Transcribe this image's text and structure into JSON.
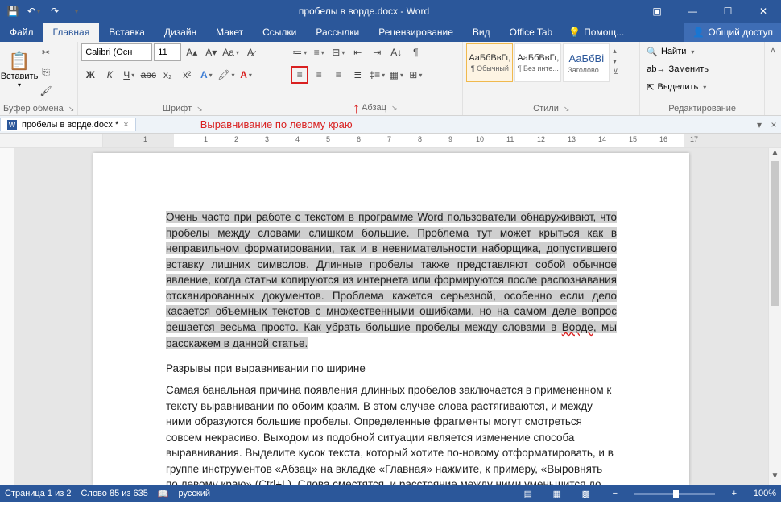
{
  "title": "пробелы в ворде.docx - Word",
  "qat": {
    "save": "💾",
    "undo": "↶",
    "redo": "↷"
  },
  "tabs": {
    "file": "Файл",
    "items": [
      "Главная",
      "Вставка",
      "Дизайн",
      "Макет",
      "Ссылки",
      "Рассылки",
      "Рецензирование",
      "Вид",
      "Office Tab"
    ],
    "help": "Помощ...",
    "share": "Общий доступ"
  },
  "ribbon": {
    "clipboard": {
      "paste": "Вставить",
      "label": "Буфер обмена"
    },
    "font": {
      "name": "Calibri (Осн",
      "size": "11",
      "label": "Шрифт"
    },
    "paragraph": {
      "label": "Абзац"
    },
    "styles": {
      "label": "Стили",
      "items": [
        {
          "sample": "АаБбВвГг,",
          "name": "¶ Обычный"
        },
        {
          "sample": "АаБбВвГг,",
          "name": "¶ Без инте..."
        },
        {
          "sample": "АаБбВі",
          "name": "Заголово..."
        }
      ]
    },
    "editing": {
      "find": "Найти",
      "replace": "Заменить",
      "select": "Выделить",
      "label": "Редактирование"
    }
  },
  "annotation": "Выравнивание по левому краю",
  "doc_tab": {
    "name": "пробелы в ворде.docx *"
  },
  "ruler_ticks": [
    "1",
    "1",
    "2",
    "3",
    "4",
    "5",
    "6",
    "7",
    "8",
    "9",
    "10",
    "11",
    "12",
    "13",
    "14",
    "15",
    "16",
    "17"
  ],
  "document": {
    "p1_sel": "Очень часто при работе с текстом в программе Word пользователи обнаруживают, что пробелы между словами слишком большие. Проблема тут может крыться как в неправильном форматировании, так и в невнимательности наборщика, допустившего вставку лишних символов. Длинные пробелы также представляют собой обычное явление, когда статьи копируются из интернета или формируются после распознавания отсканированных документов. Проблема кажется серьезной, особенно если дело касается объемных текстов с множественными ошибками, но на самом деле вопрос решается весьма просто. Как убрать большие пробелы между словами в ",
    "p1_word": "Ворде",
    "p1_tail": ", мы расскажем в данной статье.",
    "h1": "Разрывы при выравнивании по ширине",
    "p2": "Самая банальная причина появления длинных пробелов заключается в примененном к тексту выравнивании по обоим краям. В этом случае слова растягиваются, и между ними образуются большие пробелы. Определенные фрагменты могут смотреться совсем некрасиво. Выходом из подобной ситуации является изменение способа выравнивания. Выделите кусок текста, который хотите по-новому отформатировать, и в группе инструментов «Абзац» на вкладке «Главная» нажмите, к примеру, «Выровнять по левому краю» (Ctrl+L). Слова сместятся, и расстояние между ними уменьшится до стандартного, привычного глазу."
  },
  "status": {
    "page": "Страница 1 из 2",
    "words": "Слово 85 из 635",
    "lang": "русский",
    "zoom": "100%"
  }
}
